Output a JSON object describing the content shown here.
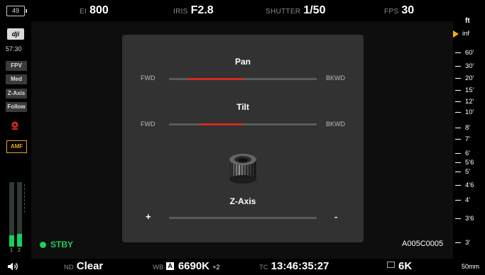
{
  "status_bar": {
    "battery": "49",
    "ei_label": "EI",
    "ei_value": "800",
    "iris_label": "IRIS",
    "iris_value": "F2.8",
    "shutter_label": "SHUTTER",
    "shutter_value": "1/50",
    "fps_label": "FPS",
    "fps_value": "30"
  },
  "sidebar": {
    "brand": "dji",
    "time": "57:30",
    "buttons": [
      "FPV",
      "Med",
      "Z-Axis",
      "Follow"
    ],
    "amf": "AMF",
    "audio_channels": [
      "1",
      "2"
    ],
    "audio_levels": [
      0.18,
      0.2
    ]
  },
  "panel": {
    "pan_title": "Pan",
    "pan_left": "FWD",
    "pan_right": "BKWD",
    "pan_range": [
      0.13,
      0.5
    ],
    "tilt_title": "Tilt",
    "tilt_left": "FWD",
    "tilt_right": "BKWD",
    "tilt_range": [
      0.21,
      0.5
    ],
    "zaxis_title": "Z-Axis",
    "zaxis_left": "+",
    "zaxis_right": "-"
  },
  "focus_scale": {
    "unit": "ft",
    "ticks": [
      "inf",
      "60'",
      "30'",
      "20'",
      "15'",
      "12'",
      "10'",
      "8'",
      "7'",
      "6'",
      "5'6",
      "5'",
      "4'6",
      "4'",
      "3'6",
      "3'"
    ],
    "current": "inf"
  },
  "recording": {
    "status": "STBY",
    "clip_name": "A005C0005"
  },
  "bottom_bar": {
    "volume_icon": "speaker-icon",
    "nd_label": "ND",
    "nd_value": "Clear",
    "wb_label": "WB",
    "wb_mode": "A",
    "wb_value": "6690K",
    "wb_tint": "+2",
    "tc_label": "TC",
    "tc_value": "13:46:35:27",
    "resolution": "6K",
    "lens": "50mm"
  }
}
